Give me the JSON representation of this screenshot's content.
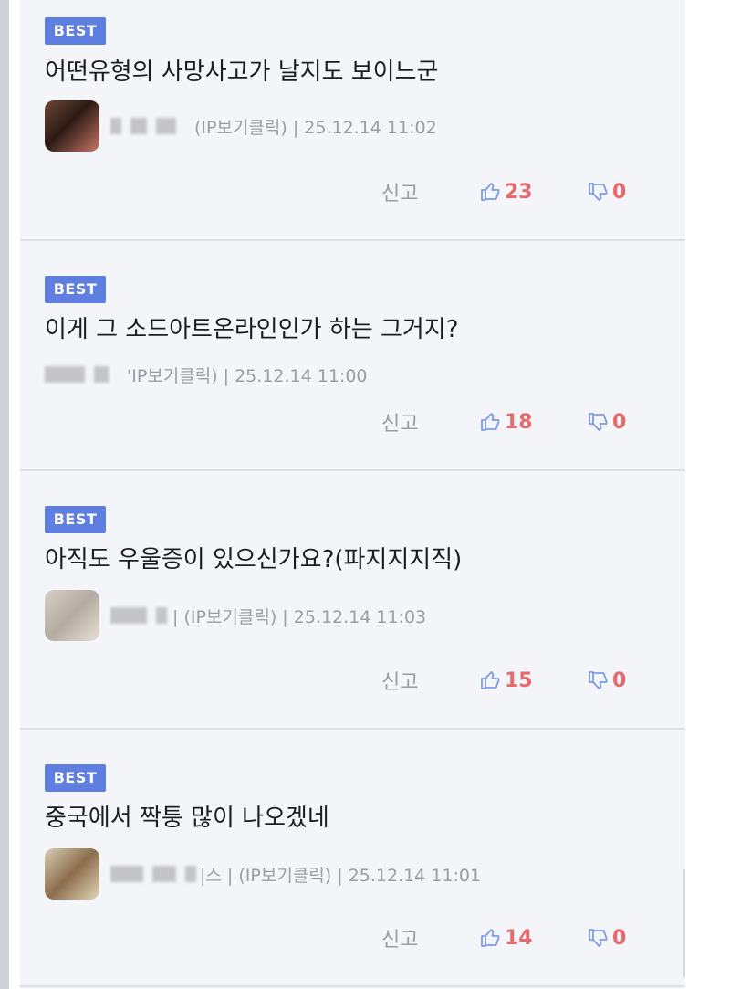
{
  "comments": [
    {
      "badge": "BEST",
      "text": "어떤유형의 사망사고가 날지도 보이느군",
      "meta": "(IP보기클릭) | 25.12.14 11:02",
      "report_label": "신고",
      "likes": "23",
      "dislikes": "0"
    },
    {
      "badge": "BEST",
      "text": "이게 그 소드아트온라인인가 하는 그거지?",
      "meta": "'IP보기클릭) | 25.12.14 11:00",
      "report_label": "신고",
      "likes": "18",
      "dislikes": "0"
    },
    {
      "badge": "BEST",
      "text": "아직도 우울증이 있으신가요?(파지지지직)",
      "meta": "| (IP보기클릭) | 25.12.14 11:03",
      "report_label": "신고",
      "likes": "15",
      "dislikes": "0"
    },
    {
      "badge": "BEST",
      "text": "중국에서 짝퉁 많이 나오겠네",
      "meta": "|스 | (IP보기클릭) | 25.12.14 11:01",
      "report_label": "신고",
      "likes": "14",
      "dislikes": "0"
    }
  ],
  "colors": {
    "badge": "#5e7fe0",
    "count": "#e8696b",
    "icon": "#7e9be6",
    "background": "#f3f5f9"
  },
  "icons": {
    "like": "thumbs-up-icon",
    "dislike": "thumbs-down-icon"
  }
}
